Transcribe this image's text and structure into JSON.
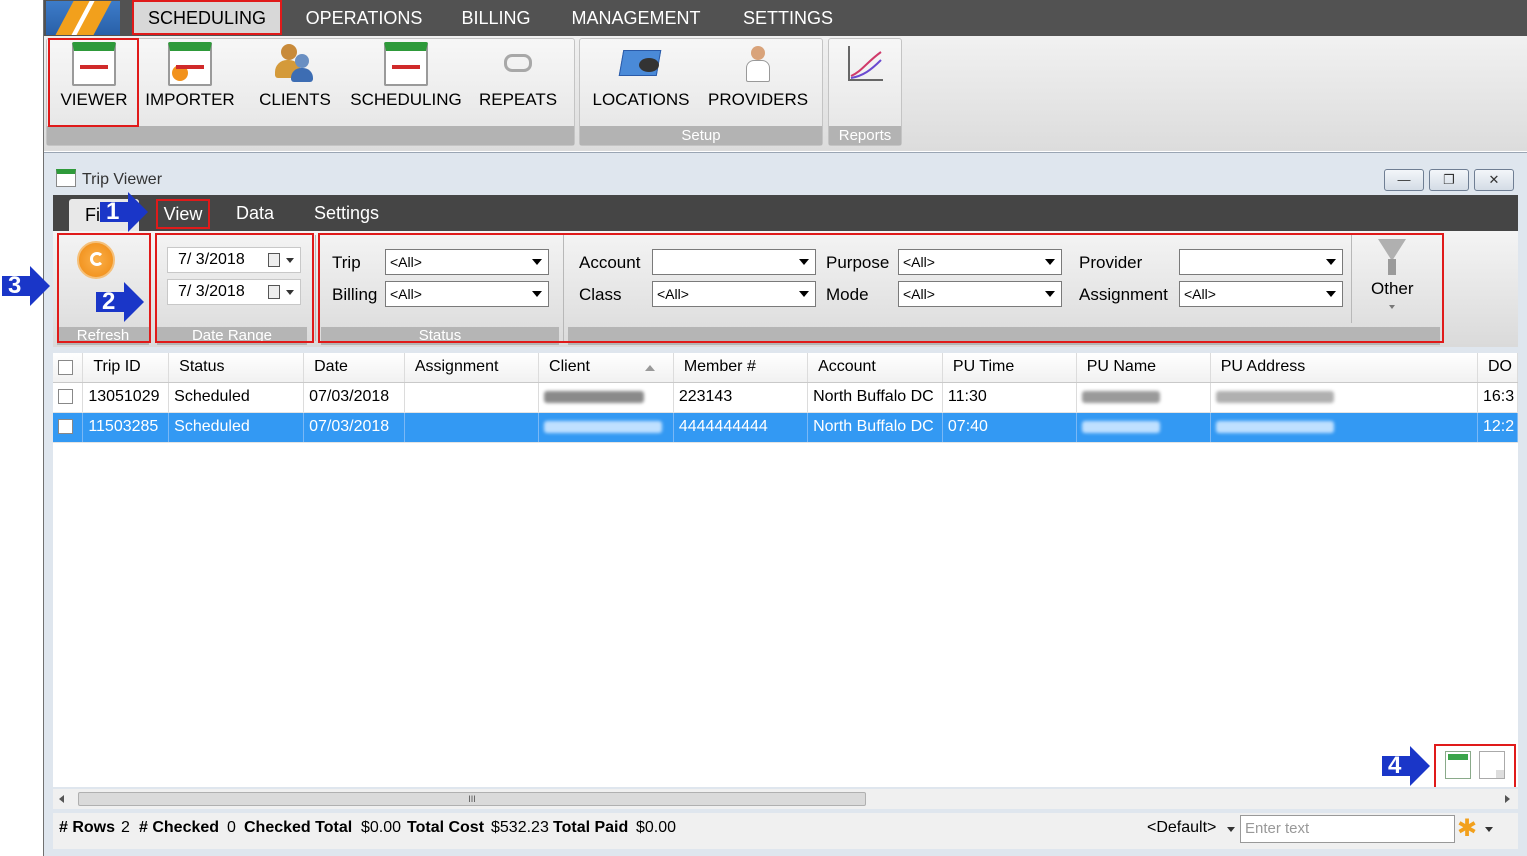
{
  "menubar": {
    "items": [
      "SCHEDULING",
      "OPERATIONS",
      "BILLING",
      "MANAGEMENT",
      "SETTINGS"
    ]
  },
  "ribbon": {
    "buttons": {
      "viewer": "VIEWER",
      "importer": "IMPORTER",
      "clients": "CLIENTS",
      "scheduling": "SCHEDULING",
      "repeats": "REPEATS",
      "locations": "LOCATIONS",
      "providers": "PROVIDERS"
    },
    "groups": {
      "setup": "Setup",
      "reports": "Reports"
    }
  },
  "window": {
    "title": "Trip Viewer",
    "min": "—",
    "restore": "❐",
    "close": "✕"
  },
  "tabs": {
    "file": "File",
    "view": "View",
    "data": "Data",
    "settings": "Settings"
  },
  "toolbar": {
    "refresh_label": "Refresh",
    "date_from": "7/ 3/2018",
    "date_to": "7/ 3/2018",
    "date_range_label": "Date Range",
    "status_label": "Status",
    "trip_label": "Trip",
    "trip_value": "<All>",
    "billing_label": "Billing",
    "billing_value": "<All>",
    "account_label": "Account",
    "account_value": "",
    "class_label": "Class",
    "class_value": "<All>",
    "purpose_label": "Purpose",
    "purpose_value": "<All>",
    "mode_label": "Mode",
    "mode_value": "<All>",
    "provider_label": "Provider",
    "provider_value": "",
    "assignment_label": "Assignment",
    "assignment_value": "<All>",
    "other_label": "Other"
  },
  "grid": {
    "columns": [
      "Trip ID",
      "Status",
      "Date",
      "Assignment",
      "Client",
      "Member #",
      "Account",
      "PU Time",
      "PU Name",
      "PU Address",
      "DO"
    ],
    "rows": [
      {
        "trip_id": "13051029",
        "status": "Scheduled",
        "date": "07/03/2018",
        "assignment": "",
        "member": "223143",
        "account": "North Buffalo DC",
        "pu_time": "11:30",
        "do": "16:3"
      },
      {
        "trip_id": "11503285",
        "status": "Scheduled",
        "date": "07/03/2018",
        "assignment": "",
        "member": "4444444444",
        "account": "North Buffalo DC",
        "pu_time": "07:40",
        "do": "12:2"
      }
    ]
  },
  "scroll": {
    "thumb_grip": "III"
  },
  "status": {
    "rows_label": "# Rows",
    "rows": "2",
    "checked_label": "# Checked",
    "checked": "0",
    "checked_total_label": "Checked Total",
    "checked_total": "$0.00",
    "total_cost_label": "Total Cost",
    "total_cost": "$532.23",
    "total_paid_label": "Total Paid",
    "total_paid": "$0.00",
    "layout": "<Default>",
    "search_placeholder": "Enter text"
  },
  "annotations": {
    "a1": "1",
    "a2": "2",
    "a3": "3",
    "a4": "4"
  },
  "colors": {
    "highlight": "#e01a1a",
    "selection": "#3399f3",
    "arrow": "#1a36c8"
  }
}
